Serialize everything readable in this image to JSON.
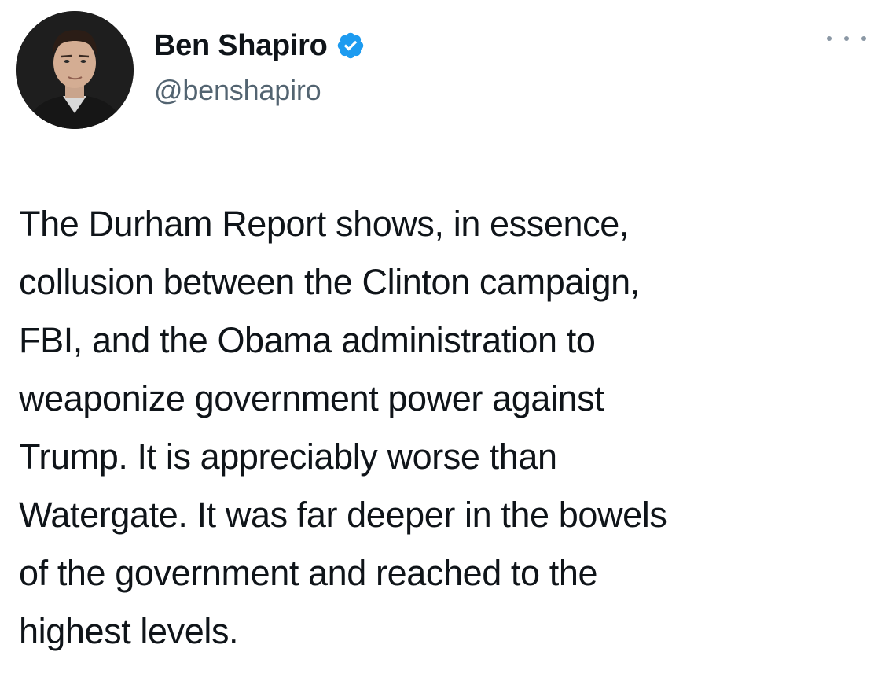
{
  "author": {
    "display_name": "Ben Shapiro",
    "handle": "@benshapiro",
    "verified": true,
    "verified_color": "#1d9bf0"
  },
  "menu": {
    "icon": "more-horizontal-icon"
  },
  "tweet": {
    "lines": [
      "The Durham Report shows, in essence,",
      "collusion between the Clinton campaign,",
      "FBI, and the Obama administration to",
      "weaponize government power against",
      "Trump. It is appreciably worse than",
      "Watergate. It was far deeper in the bowels",
      "of the government and reached to the",
      "highest levels."
    ]
  }
}
